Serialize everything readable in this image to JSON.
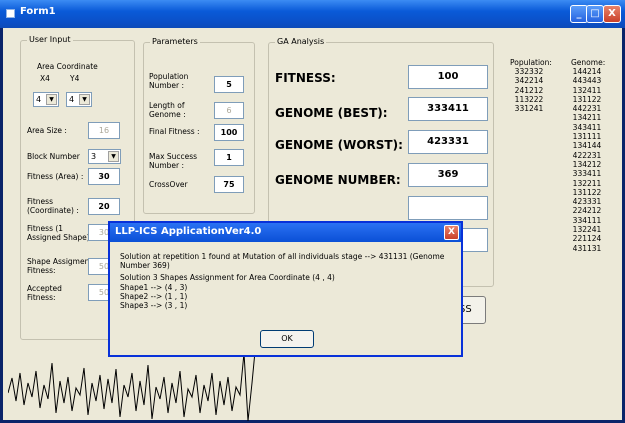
{
  "window": {
    "title": "Form1",
    "btn_min": "_",
    "btn_max": "□",
    "btn_close": "X"
  },
  "user_input": {
    "legend": "User Input",
    "area_coord_label": "Area Coordinate",
    "x_label": "X4",
    "y_label": "Y4",
    "x_value": "4",
    "y_value": "4",
    "area_size_label": "Area Size :",
    "area_size_value": "16",
    "block_number_label": "Block Number",
    "block_number_value": "3",
    "fitness_area_label": "Fitness (Area) :",
    "fitness_area_value": "30",
    "fitness_coord_label_1": "Fitness",
    "fitness_coord_label_2": "(Coordinate) :",
    "fitness_coord_value": "20",
    "fitness_assigned_label_1": "Fitness (1",
    "fitness_assigned_label_2": "Assigned Shape) :",
    "fitness_assigned_value": "30",
    "shape_assign_label_1": "Shape Assigment",
    "shape_assign_label_2": "Fitness:",
    "shape_assign_value": "50",
    "accepted_label_1": "Accepted",
    "accepted_label_2": "Fitness:",
    "accepted_value": "50"
  },
  "parameters": {
    "legend": "Parameters",
    "population_label_1": "Population",
    "population_label_2": "Number :",
    "population_value": "5",
    "length_label_1": "Length of",
    "length_label_2": "Genome :",
    "length_value": "6",
    "final_fitness_label": "Final Fitness :",
    "final_fitness_value": "100",
    "max_success_label_1": "Max Success",
    "max_success_label_2": "Number :",
    "max_success_value": "1",
    "crossover_label": "CrossOver",
    "crossover_value": "75"
  },
  "ga_analysis": {
    "legend": "GA Analysis",
    "fitness_label": "FITNESS:",
    "fitness_value": "100",
    "best_label": "GENOME (BEST):",
    "best_value": "333411",
    "worst_label": "GENOME (WORST):",
    "worst_value": "423331",
    "number_label": "GENOME NUMBER:",
    "number_value": "369"
  },
  "lists": {
    "population_header": "Population:",
    "population_values": [
      "332332",
      "342214",
      "241212",
      "113222",
      "331241"
    ],
    "genome_header": "Genome:",
    "genome_values": [
      "144214",
      "443443",
      "132411",
      "131122",
      "442231",
      "134211",
      "343411",
      "131111",
      "134144",
      "422231",
      "134212",
      "333411",
      "132211",
      "131122",
      "423331",
      "224212",
      "334111",
      "132241",
      "221124",
      "431131"
    ]
  },
  "side_button": {
    "label": "SS"
  },
  "dialog": {
    "title": "LLP-ICS ApplicationVer4.0",
    "close": "X",
    "line1": "Solution at repetition 1 found at Mutation of all individuals stage --> 431131 (Genome Number 369)",
    "line2": "Solution 3 Shapes Assignment for Area Coordinate (4 , 4)",
    "line3": "Shape1 --> (4 , 3)",
    "line4": "Shape2 --> (1 , 1)",
    "line5": "Shape3 --> (3 , 1)",
    "ok": "OK"
  }
}
